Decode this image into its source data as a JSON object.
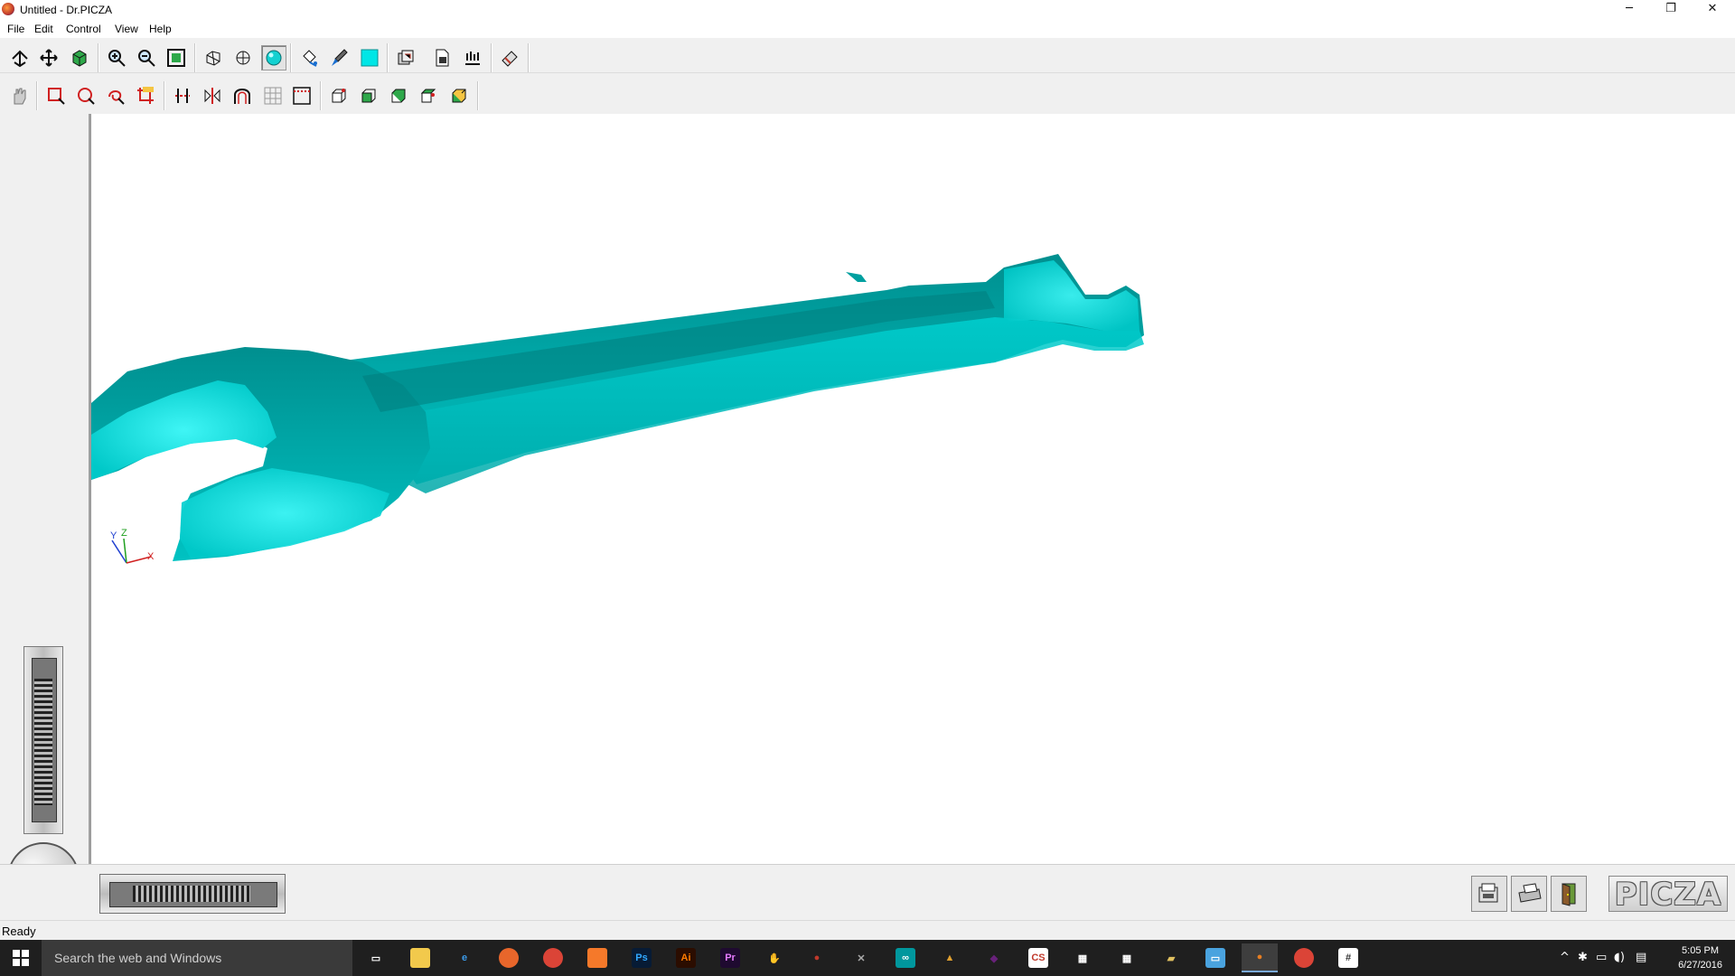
{
  "window": {
    "title": "Untitled - Dr.PICZA",
    "controls": {
      "minimize": "─",
      "restore": "❐",
      "close": "✕"
    }
  },
  "menu": [
    "File",
    "Edit",
    "Control",
    "View",
    "Help"
  ],
  "toolbar1": [
    {
      "name": "rotate-view-icon",
      "glyph": "rotate"
    },
    {
      "name": "pan-view-icon",
      "glyph": "move"
    },
    {
      "name": "cube-view-icon",
      "glyph": "cube"
    },
    {
      "name": "zoom-in-icon",
      "glyph": "zoomin"
    },
    {
      "name": "zoom-out-icon",
      "glyph": "zoomout"
    },
    {
      "name": "zoom-fit-icon",
      "glyph": "fit"
    },
    {
      "name": "wireframe-icon",
      "glyph": "wire"
    },
    {
      "name": "hidden-line-icon",
      "glyph": "hidden"
    },
    {
      "name": "shaded-sphere-icon",
      "glyph": "sphere",
      "pressed": true
    },
    {
      "name": "paint-bucket-icon",
      "glyph": "bucket"
    },
    {
      "name": "brush-icon",
      "glyph": "brush"
    },
    {
      "name": "color-swatch-icon",
      "glyph": "swatch"
    },
    {
      "name": "render-settings-icon",
      "glyph": "render"
    },
    {
      "name": "export-doc-icon",
      "glyph": "doc"
    },
    {
      "name": "scan-icon",
      "glyph": "scan"
    },
    {
      "name": "eraser-icon",
      "glyph": "eraser"
    }
  ],
  "toolbar2": [
    {
      "name": "hand-icon",
      "glyph": "hand"
    },
    {
      "name": "select-rect-icon",
      "glyph": "rect"
    },
    {
      "name": "select-circle-icon",
      "glyph": "circle"
    },
    {
      "name": "select-lasso-icon",
      "glyph": "lasso"
    },
    {
      "name": "crop-icon",
      "glyph": "crop"
    },
    {
      "name": "cut-icon",
      "glyph": "cut"
    },
    {
      "name": "mirror-icon",
      "glyph": "mirror"
    },
    {
      "name": "arch-icon",
      "glyph": "arch"
    },
    {
      "name": "grid-icon",
      "glyph": "grid"
    },
    {
      "name": "frame-icon",
      "glyph": "frame"
    },
    {
      "name": "box-front-icon",
      "glyph": "box1"
    },
    {
      "name": "box-side-icon",
      "glyph": "box2"
    },
    {
      "name": "box-back-icon",
      "glyph": "box3"
    },
    {
      "name": "box-top-icon",
      "glyph": "box4"
    },
    {
      "name": "box-iso-icon",
      "glyph": "box5"
    }
  ],
  "axes": {
    "y": "Y",
    "z": "Z",
    "x": "X"
  },
  "colors": {
    "model": "#00b8b8",
    "model_light": "#19e6e6",
    "model_dark": "#006b6b"
  },
  "bottom_buttons": [
    {
      "name": "scan-device-icon"
    },
    {
      "name": "print-icon"
    },
    {
      "name": "exit-door-icon"
    }
  ],
  "logo": "PICZA",
  "status": "Ready",
  "taskbar": {
    "search_placeholder": "Search the web and Windows",
    "apps": [
      {
        "name": "task-view-icon",
        "label": "▭",
        "bg": "transparent",
        "fg": "#fff"
      },
      {
        "name": "file-explorer-icon",
        "label": "",
        "bg": "#f2c94c",
        "fg": "#000"
      },
      {
        "name": "edge-icon",
        "label": "e",
        "bg": "transparent",
        "fg": "#3b9bea"
      },
      {
        "name": "firefox-icon",
        "label": "",
        "bg": "#e8662b",
        "fg": "#fff"
      },
      {
        "name": "chrome-icon",
        "label": "",
        "bg": "#db4437",
        "fg": "#fff"
      },
      {
        "name": "blender-icon",
        "label": "",
        "bg": "#f5792a",
        "fg": "#fff"
      },
      {
        "name": "photoshop-icon",
        "label": "Ps",
        "bg": "#071b35",
        "fg": "#31a8ff"
      },
      {
        "name": "illustrator-icon",
        "label": "Ai",
        "bg": "#2b0d00",
        "fg": "#ff7c00"
      },
      {
        "name": "premiere-icon",
        "label": "Pr",
        "bg": "#1f0a30",
        "fg": "#e77cff"
      },
      {
        "name": "app-hand-icon",
        "label": "✋",
        "bg": "transparent",
        "fg": "#ddd"
      },
      {
        "name": "app-red-icon",
        "label": "●",
        "bg": "transparent",
        "fg": "#c0392b"
      },
      {
        "name": "app-tools-icon",
        "label": "✕",
        "bg": "transparent",
        "fg": "#aaa"
      },
      {
        "name": "arduino-icon",
        "label": "∞",
        "bg": "#00979d",
        "fg": "#fff"
      },
      {
        "name": "app-wizard-icon",
        "label": "▲",
        "bg": "transparent",
        "fg": "#e0a030"
      },
      {
        "name": "visual-studio-icon",
        "label": "◆",
        "bg": "transparent",
        "fg": "#68217a"
      },
      {
        "name": "eagle-icon",
        "label": "CS",
        "bg": "#fff",
        "fg": "#c0392b"
      },
      {
        "name": "calculator-icon",
        "label": "▦",
        "bg": "transparent",
        "fg": "#fff"
      },
      {
        "name": "calendar-icon",
        "label": "▦",
        "bg": "transparent",
        "fg": "#fff"
      },
      {
        "name": "app-folder-icon",
        "label": "▰",
        "bg": "transparent",
        "fg": "#e0c060"
      },
      {
        "name": "app-monitor-icon",
        "label": "▭",
        "bg": "#4aa3df",
        "fg": "#fff"
      },
      {
        "name": "drpicza-icon",
        "label": "●",
        "bg": "transparent",
        "fg": "#e67e22",
        "active": true
      },
      {
        "name": "chrome-2-icon",
        "label": "",
        "bg": "#db4437",
        "fg": "#fff"
      },
      {
        "name": "slack-icon",
        "label": "#",
        "bg": "#fff",
        "fg": "#333"
      }
    ],
    "time": "5:05 PM",
    "date": "6/27/2016"
  }
}
